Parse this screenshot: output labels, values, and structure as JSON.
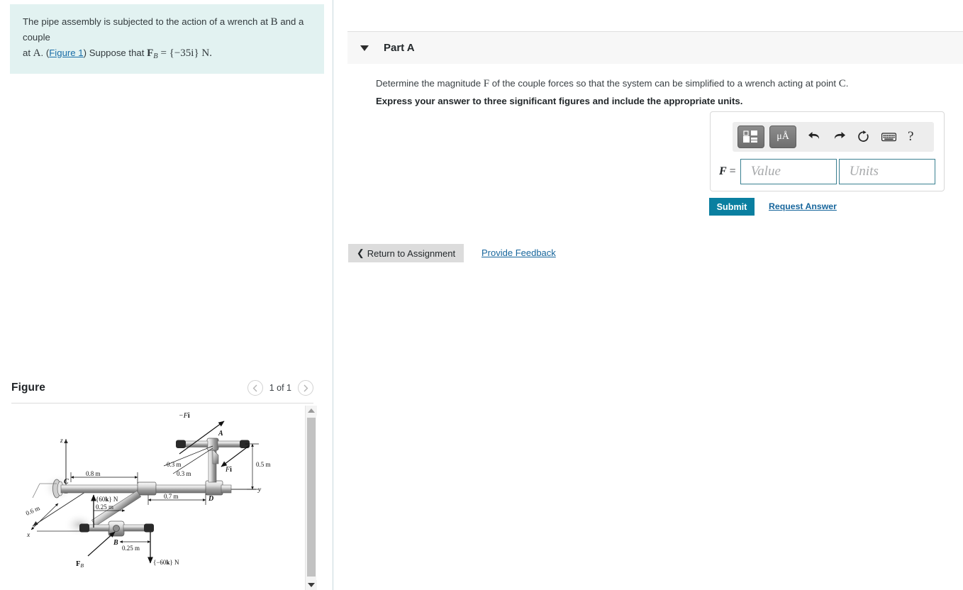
{
  "problem": {
    "line1_a": "The pipe assembly is subjected to the action of a wrench at ",
    "var_B": "B",
    "line1_b": " and a couple",
    "line2_a": "at ",
    "var_A": "A",
    "line2_b": ". (",
    "figure_link": "Figure 1",
    "line2_c": ") Suppose that ",
    "eq_F": "F",
    "eq_Bsub": "B",
    "eq_rest": " = {−35i} N."
  },
  "part": {
    "label": "Part A",
    "question_a": "Determine the magnitude ",
    "question_var_F": "F",
    "question_b": " of the couple forces so that the system can be simplified to a wrench acting at point ",
    "question_var_C": "C",
    "question_c": ".",
    "instruction": "Express your answer to three significant figures and include the appropriate units."
  },
  "answer": {
    "field_label_F": "F",
    "field_label_eq": " =",
    "value_placeholder": "Value",
    "units_placeholder": "Units",
    "value_current": "",
    "units_current": "",
    "toolbar": {
      "template_icon": "template-icon",
      "units_icon": "μÅ",
      "undo_icon": "undo-icon",
      "redo_icon": "redo-icon",
      "reset_icon": "reset-icon",
      "keyboard_icon": "keyboard-icon",
      "help_icon": "?"
    },
    "submit_label": "Submit",
    "request_answer_label": "Request Answer"
  },
  "footer": {
    "return_label": "Return to Assignment",
    "return_chevron": "❮",
    "feedback_label": "Provide Feedback"
  },
  "figure": {
    "title": "Figure",
    "counter": "1 of 1",
    "prev_icon": "chevron-left-icon",
    "next_icon": "chevron-right-icon",
    "labels": {
      "force_neg_Fi": "−Fi",
      "point_A": "A",
      "point_B": "B",
      "point_C": "C",
      "point_D": "D",
      "force_Fi": "Fi",
      "force_FB": "F",
      "force_FB_sub": "B",
      "dim_08": "0.8 m",
      "dim_06": "0.6 m",
      "dim_07": "0.7 m",
      "dim_05": "0.5 m",
      "dim_03a": "0.3 m",
      "dim_03b": "0.3 m",
      "dim_025a": "0.25 m",
      "dim_025b": "0.25 m",
      "couple_up": "{60k} N",
      "couple_down": "{−60k} N",
      "axis_x": "x",
      "axis_y": "y",
      "axis_z": "z"
    }
  },
  "colors": {
    "problem_bg": "#e2f2f1",
    "submit_bg": "#0a7fa0",
    "link": "#17669c",
    "field_border": "#3a8091",
    "panel_divider": "#c8d8dd"
  }
}
